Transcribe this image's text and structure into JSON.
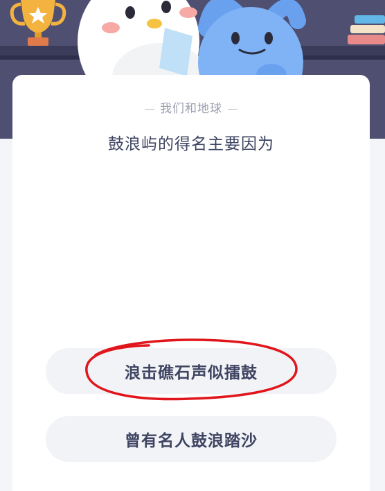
{
  "quiz": {
    "category": "我们和地球",
    "question": "鼓浪屿的得名主要因为",
    "options": [
      {
        "label": "浪击礁石声似擂鼓"
      },
      {
        "label": "曾有名人鼓浪踏沙"
      }
    ],
    "circled_option_index": 0
  },
  "colors": {
    "banner": "#4f4f72",
    "card": "#ffffff",
    "option_bg": "#f1f3f6",
    "text_dark": "#3e4461",
    "text_muted": "#9a9eb0",
    "annotation_red": "#e0161c"
  },
  "icons": [
    "trophy-icon",
    "star-icon",
    "penguin-mascot",
    "blue-mascot",
    "books-icon"
  ]
}
